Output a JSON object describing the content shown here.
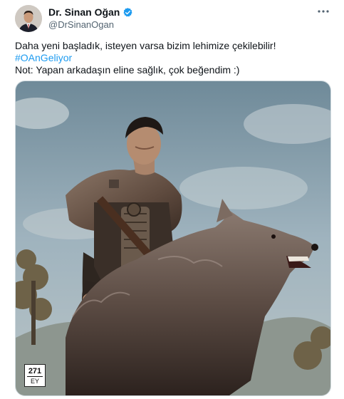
{
  "tweet": {
    "author": {
      "display_name": "Dr. Sinan Oğan",
      "handle": "@DrSinanOgan",
      "verified_icon": "verified-badge-icon",
      "avatar_icon": "profile-avatar"
    },
    "more_icon": "more-horizontal-icon",
    "text": {
      "line1": "Daha yeni başladık, isteyen varsa bizim lehimize çekilebilir!",
      "hashtag": "#OAnGeliyor",
      "line3": "Not: Yapan arkadaşın eline sağlık, çok beğendim :)"
    },
    "media": {
      "watermark_top": "271",
      "watermark_bottom": "EY"
    },
    "colors": {
      "link": "#1d9bf0",
      "verified": "#1d9bf0",
      "secondary_text": "#536471"
    }
  }
}
